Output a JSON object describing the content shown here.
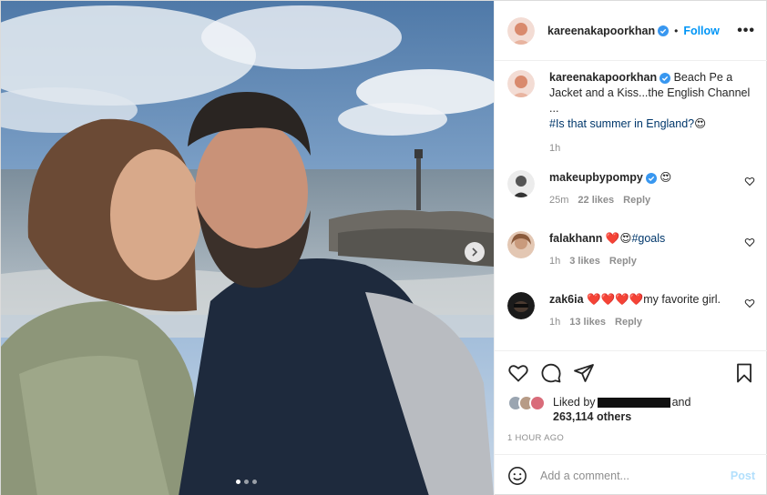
{
  "post_photo": {
    "description_icon": "beach-selfie-photo"
  },
  "carousel": {
    "next_icon": "chevron-right-icon",
    "dot_count": 3,
    "active_dot": 1
  },
  "header": {
    "username": "kareenakapoorkhan",
    "separator": "•",
    "follow_label": "Follow",
    "more_icon": "more-horizontal-icon",
    "more_label": "•••"
  },
  "caption": {
    "username": "kareenakapoorkhan",
    "text_line1": "Beach Pe a",
    "text_line2": "Jacket and a Kiss...the English Channel",
    "text_line3": "...",
    "hashtag": "#Is that summer in England?",
    "emoji": "😍",
    "time": "1h"
  },
  "comments": [
    {
      "username": "makeupbypompy",
      "verified": true,
      "text": "😍",
      "time": "25m",
      "likes": "22 likes",
      "reply": "Reply"
    },
    {
      "username": "falakhann",
      "verified": false,
      "text": "❤️😍",
      "hashtag": "#goals",
      "time": "1h",
      "likes": "3 likes",
      "reply": "Reply"
    },
    {
      "username": "zak6ia",
      "verified": false,
      "text": "❤️❤️❤️❤️my favorite girl.",
      "time": "1h",
      "likes": "13 likes",
      "reply": "Reply"
    }
  ],
  "actions": {
    "like_icon": "heart-icon",
    "comment_icon": "comment-icon",
    "share_icon": "share-icon",
    "save_icon": "bookmark-icon"
  },
  "likes": {
    "prefix": "Liked by",
    "suffix": "and",
    "count_text": "263,114 others"
  },
  "timestamp": "1 HOUR AGO",
  "add_comment": {
    "emoji_icon": "smiley-icon",
    "placeholder": "Add a comment...",
    "post_label": "Post"
  },
  "colors": {
    "accent": "#0095f6",
    "verified": "#3897f0",
    "post_disabled": "#b2dffc",
    "heart": "#ed4956"
  }
}
